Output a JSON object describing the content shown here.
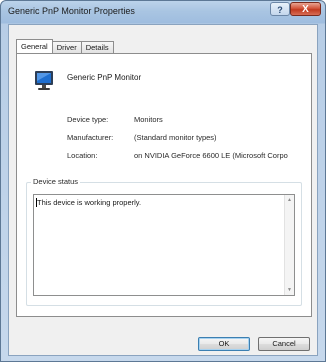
{
  "window": {
    "title": "Generic PnP Monitor Properties",
    "help_label": "?",
    "close_label": "X"
  },
  "tabs": [
    {
      "label": "General",
      "active": true
    },
    {
      "label": "Driver",
      "active": false
    },
    {
      "label": "Details",
      "active": false
    }
  ],
  "device": {
    "name": "Generic PnP Monitor",
    "icon": "monitor-icon"
  },
  "properties": [
    {
      "label": "Device type:",
      "value": "Monitors"
    },
    {
      "label": "Manufacturer:",
      "value": "(Standard monitor types)"
    },
    {
      "label": "Location:",
      "value": "on NVIDIA GeForce 6600 LE (Microsoft Corpo"
    }
  ],
  "status": {
    "legend": "Device status",
    "text": "This device is working properly."
  },
  "buttons": {
    "ok": "OK",
    "cancel": "Cancel"
  },
  "colors": {
    "title_glass": "#a9c5e2",
    "close_red": "#c13a20",
    "default_button_border": "#3c7fb1"
  }
}
